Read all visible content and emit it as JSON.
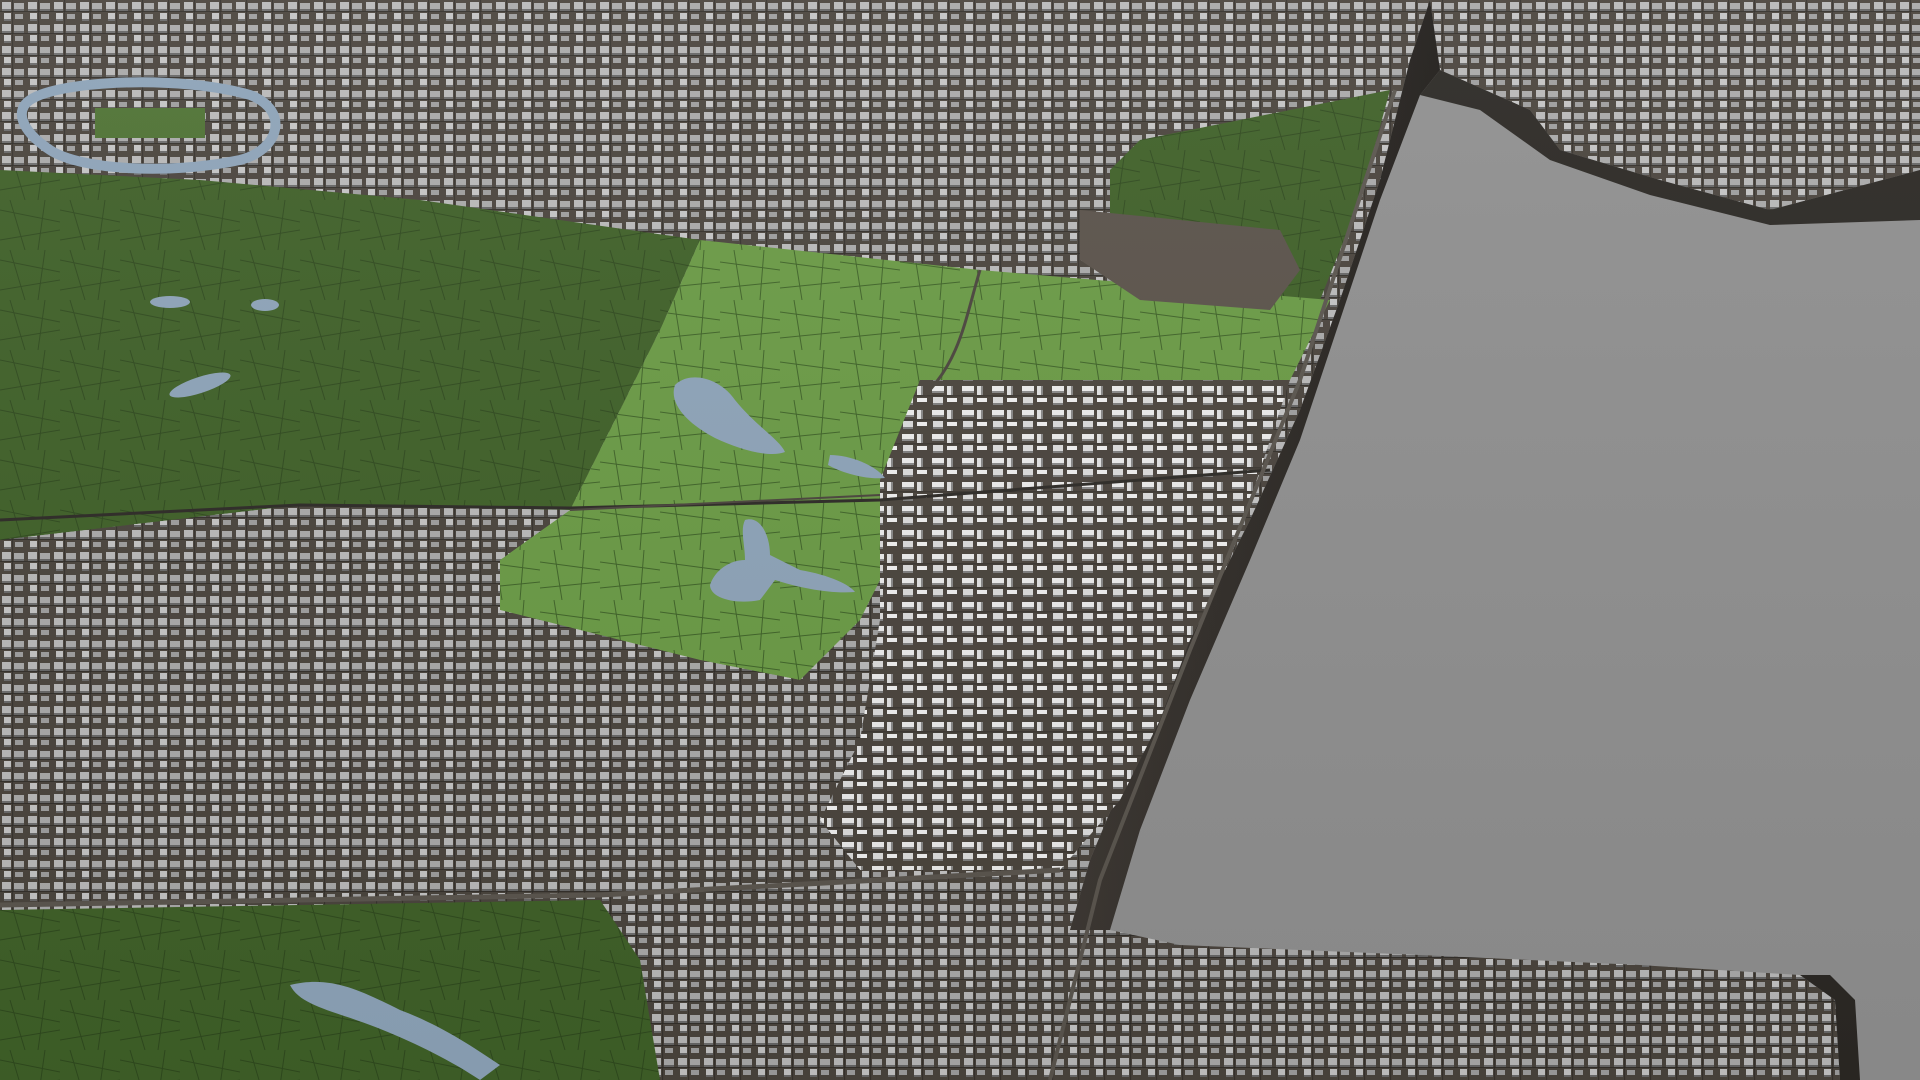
{
  "scene": {
    "kind": "3d-city-terrain-render",
    "description_visible_text": ""
  },
  "colors": {
    "background_void": "#8f8f8f",
    "terrain_ground": "#4a443d",
    "terrain_ground_dark": "#3a352f",
    "cliff_face": "#2b2824",
    "cliff_face_light": "#3d3833",
    "park_dark": "#3f6028",
    "park_mid": "#4e7233",
    "park_highlight": "#6a9a45",
    "water": "#8da3b8",
    "road": "#2d2a26",
    "road_light": "#5a554e",
    "building_light": "#d8d8d8",
    "building_mid": "#a9a9a9",
    "building_shadow": "#6e6e6e"
  },
  "regions": [
    {
      "name": "north-urban-district",
      "type": "urban"
    },
    {
      "name": "central-park-west",
      "type": "park"
    },
    {
      "name": "central-park-highlight",
      "type": "park-highlighted"
    },
    {
      "name": "east-residential-district",
      "type": "urban"
    },
    {
      "name": "south-west-urban-district",
      "type": "urban"
    },
    {
      "name": "south-park",
      "type": "park"
    },
    {
      "name": "south-east-residential",
      "type": "urban"
    },
    {
      "name": "north-east-plateau",
      "type": "urban"
    },
    {
      "name": "eastern-void",
      "type": "empty"
    }
  ],
  "water_bodies": [
    {
      "name": "river-loop-northwest"
    },
    {
      "name": "lake-central-1"
    },
    {
      "name": "lake-central-2"
    },
    {
      "name": "lake-central-3"
    },
    {
      "name": "pond-west-1"
    },
    {
      "name": "pond-west-2"
    },
    {
      "name": "river-southwest"
    }
  ]
}
